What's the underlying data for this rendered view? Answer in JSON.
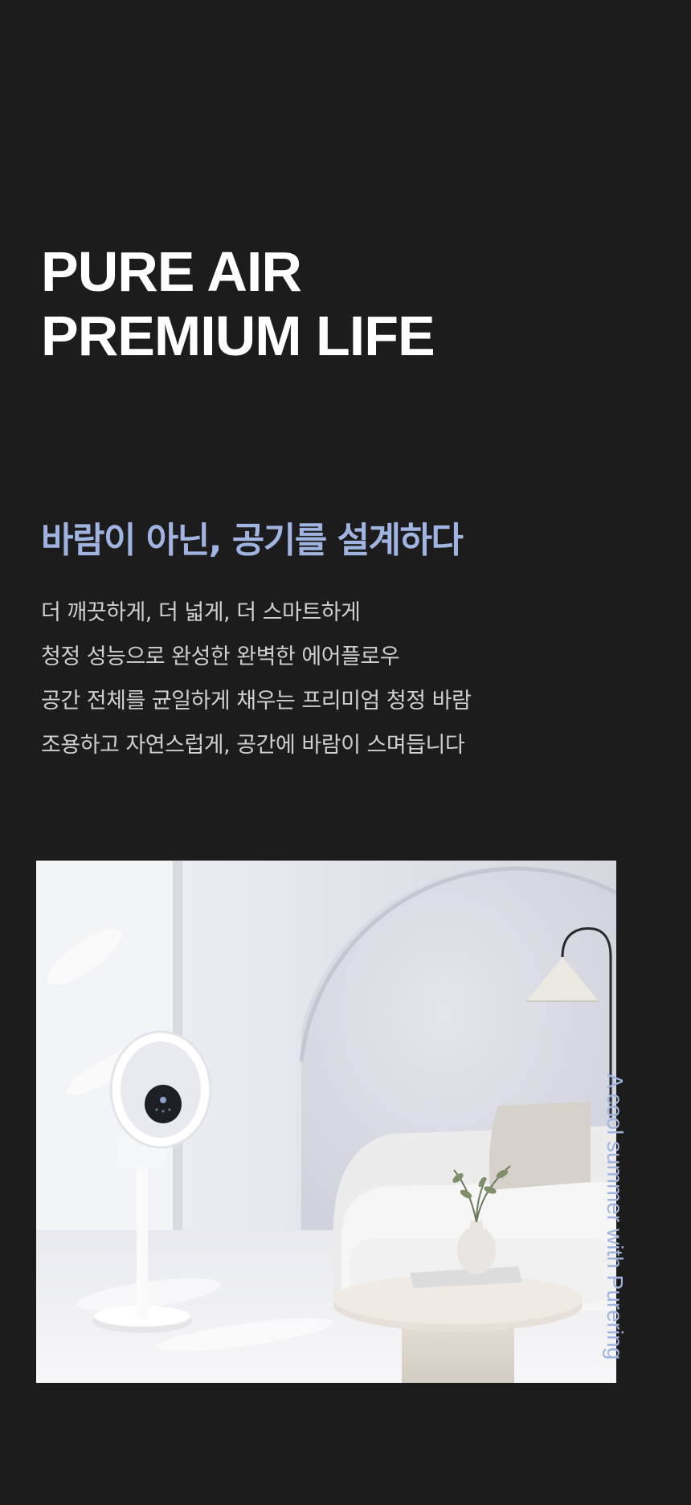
{
  "hero": {
    "line1": "PURE AIR",
    "line2": "PREMIUM LIFE"
  },
  "subhead": "바람이 아닌, 공기를 설계하다",
  "description": [
    "더 깨끗하게, 더 넓게, 더 스마트하게",
    "청정 성능으로 완성한 완벽한 에어플로우",
    "공간 전체를 균일하게 채우는 프리미엄 청정 바람",
    "조용하고 자연스럽게, 공간에 바람이 스며듭니다"
  ],
  "product_image": {
    "subject": "white bladeless ring fan beside a curved sofa, side table and floor lamp"
  },
  "side_caption": "A cool summer with Purering",
  "colors": {
    "background": "#1c1c1c",
    "headline": "#ffffff",
    "accent": "#9fb4e0",
    "body_text": "#cfcfcf"
  }
}
